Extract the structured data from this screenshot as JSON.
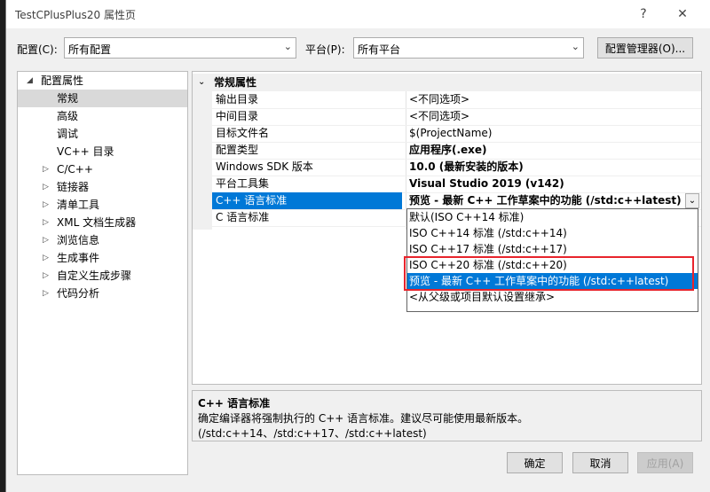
{
  "window": {
    "title": "TestCPlusPlus20 属性页",
    "help_label": "?",
    "close_label": "✕"
  },
  "toolbar": {
    "config_label": "配置(C):",
    "config_value": "所有配置",
    "platform_label": "平台(P):",
    "platform_value": "所有平台",
    "config_manager_label": "配置管理器(O)..."
  },
  "tree": {
    "root_label": "配置属性",
    "items": [
      {
        "label": "常规",
        "selected": true,
        "expandable": false
      },
      {
        "label": "高级",
        "expandable": false
      },
      {
        "label": "调试",
        "expandable": false
      },
      {
        "label": "VC++ 目录",
        "expandable": false
      },
      {
        "label": "C/C++",
        "expandable": true
      },
      {
        "label": "链接器",
        "expandable": true
      },
      {
        "label": "清单工具",
        "expandable": true
      },
      {
        "label": "XML 文档生成器",
        "expandable": true
      },
      {
        "label": "浏览信息",
        "expandable": true
      },
      {
        "label": "生成事件",
        "expandable": true
      },
      {
        "label": "自定义生成步骤",
        "expandable": true
      },
      {
        "label": "代码分析",
        "expandable": true
      }
    ]
  },
  "grid": {
    "category": "常规属性",
    "rows": [
      {
        "name": "输出目录",
        "value": "<不同选项>",
        "bold": false
      },
      {
        "name": "中间目录",
        "value": "<不同选项>",
        "bold": false
      },
      {
        "name": "目标文件名",
        "value": "$(ProjectName)",
        "bold": false
      },
      {
        "name": "配置类型",
        "value": "应用程序(.exe)",
        "bold": true
      },
      {
        "name": "Windows SDK 版本",
        "value": "10.0 (最新安装的版本)",
        "bold": true
      },
      {
        "name": "平台工具集",
        "value": "Visual Studio 2019 (v142)",
        "bold": true
      },
      {
        "name": "C++ 语言标准",
        "value": "预览 - 最新 C++ 工作草案中的功能 (/std:c++latest)",
        "bold": true,
        "selected": true
      },
      {
        "name": "C 语言标准",
        "value": "",
        "bold": false
      }
    ]
  },
  "dropdown": {
    "options": [
      {
        "label": "默认(ISO C++14 标准)"
      },
      {
        "label": "ISO C++14 标准 (/std:c++14)"
      },
      {
        "label": "ISO C++17 标准 (/std:c++17)"
      },
      {
        "label": "ISO C++20 标准 (/std:c++20)"
      },
      {
        "label": "预览 - 最新 C++ 工作草案中的功能 (/std:c++latest)",
        "selected": true
      },
      {
        "label": "<从父级或项目默认设置继承>"
      }
    ]
  },
  "description": {
    "title": "C++ 语言标准",
    "text": "确定编译器将强制执行的 C++ 语言标准。建议尽可能使用最新版本。(/std:c++14、/std:c++17、/std:c++latest)"
  },
  "footer": {
    "ok_label": "确定",
    "cancel_label": "取消",
    "apply_label": "应用(A)"
  }
}
